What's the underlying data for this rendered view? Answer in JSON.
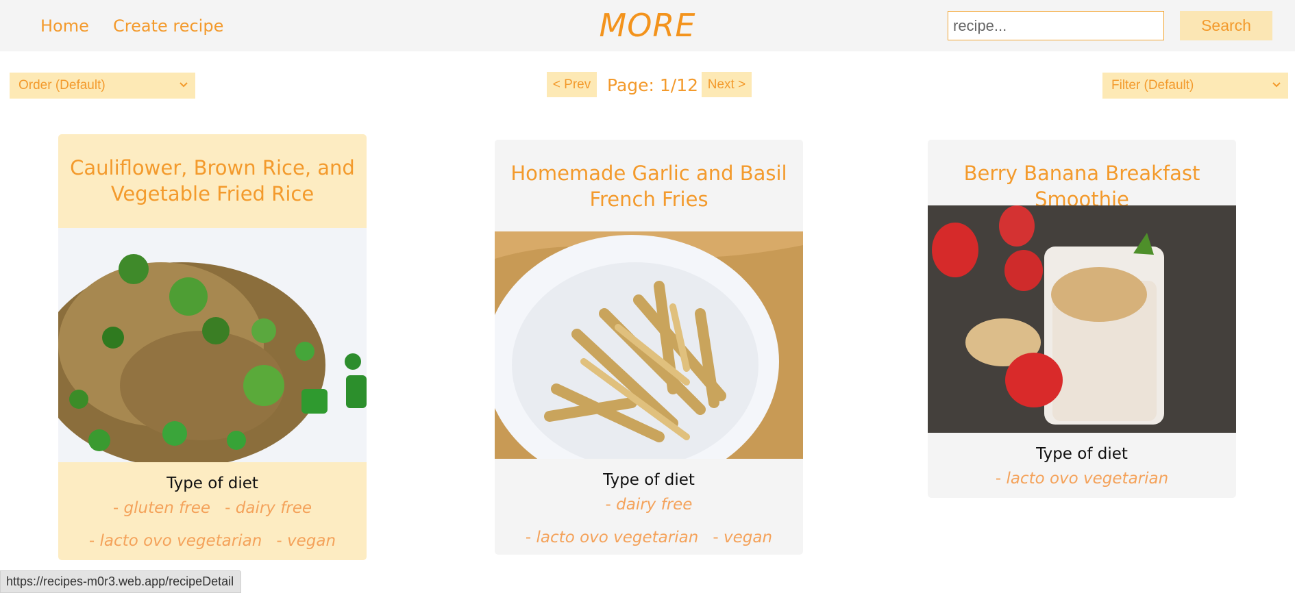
{
  "nav": {
    "home_label": "Home",
    "create_label": "Create recipe",
    "brand": "MORE",
    "search_placeholder": "recipe...",
    "search_label": "Search"
  },
  "controls": {
    "order_selected": "Order (Default)",
    "filter_selected": "Filter (Default)",
    "prev_label": "< Prev",
    "next_label": "Next >",
    "page_text": "Page: 1/12"
  },
  "recipes": [
    {
      "title": "Cauliflower, Brown Rice, and Vegetable Fried Rice",
      "diet_heading": "Type of diet",
      "diets": [
        "gluten free",
        "dairy free",
        "lacto ovo vegetarian",
        "vegan"
      ],
      "image": "fried-rice-photo"
    },
    {
      "title": "Homemade Garlic and Basil French Fries",
      "diet_heading": "Type of diet",
      "diets": [
        "dairy free",
        "lacto ovo vegetarian",
        "vegan"
      ],
      "image": "french-fries-photo"
    },
    {
      "title": "Berry Banana Breakfast Smoothie",
      "diet_heading": "Type of diet",
      "diets": [
        "lacto ovo vegetarian"
      ],
      "image": "smoothie-photo"
    }
  ],
  "status_url": "https://recipes-m0r3.web.app/recipeDetail",
  "colors": {
    "accent": "#f39a2c",
    "card_highlight": "#fdecc2",
    "card_default": "#f4f4f4",
    "button_bg": "#fde9b5"
  }
}
